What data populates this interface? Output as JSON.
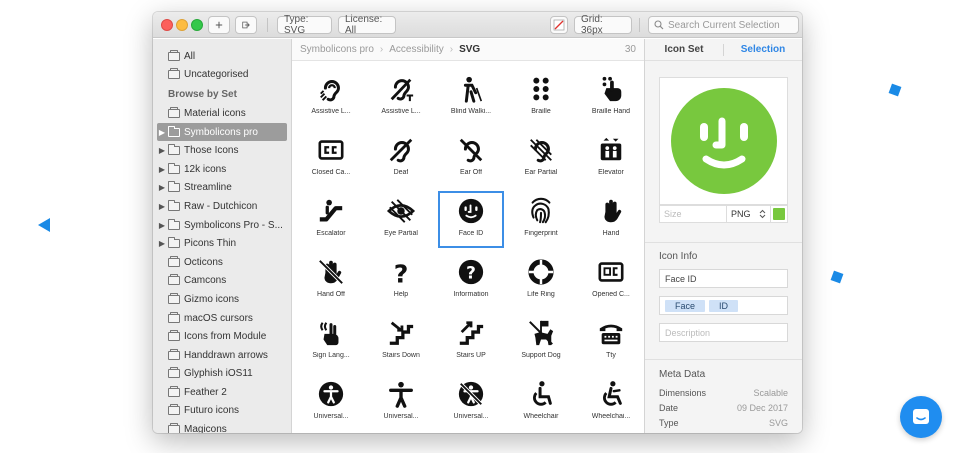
{
  "toolbar": {
    "type_filter": "Type: SVG",
    "license_filter": "License: All",
    "grid_size": "Grid: 36px",
    "search_placeholder": "Search Current Selection"
  },
  "sidebar": {
    "top_items": [
      {
        "label": "All"
      },
      {
        "label": "Uncategorised"
      }
    ],
    "section_header": "Browse by Set",
    "sets": [
      {
        "label": "Material icons",
        "expandable": false,
        "selected": false
      },
      {
        "label": "Symbolicons pro",
        "expandable": true,
        "selected": true
      },
      {
        "label": "Those Icons",
        "expandable": true,
        "selected": false
      },
      {
        "label": "12k icons",
        "expandable": true,
        "selected": false
      },
      {
        "label": "Streamline",
        "expandable": true,
        "selected": false
      },
      {
        "label": "Raw - Dutchicon",
        "expandable": true,
        "selected": false
      },
      {
        "label": "Symbolicons Pro - S...",
        "expandable": true,
        "selected": false
      },
      {
        "label": "Picons Thin",
        "expandable": true,
        "selected": false
      },
      {
        "label": "Octicons",
        "expandable": false,
        "selected": false
      },
      {
        "label": "Camcons",
        "expandable": false,
        "selected": false
      },
      {
        "label": "Gizmo icons",
        "expandable": false,
        "selected": false
      },
      {
        "label": "macOS cursors",
        "expandable": false,
        "selected": false
      },
      {
        "label": "Icons from Module",
        "expandable": false,
        "selected": false
      },
      {
        "label": "Handdrawn arrows",
        "expandable": false,
        "selected": false
      },
      {
        "label": "Glyphish iOS11",
        "expandable": false,
        "selected": false
      },
      {
        "label": "Feather 2",
        "expandable": false,
        "selected": false
      },
      {
        "label": "Futuro icons",
        "expandable": false,
        "selected": false
      },
      {
        "label": "Magicons",
        "expandable": false,
        "selected": false
      }
    ]
  },
  "breadcrumb": {
    "items": [
      "Symbolicons pro",
      "Accessibility",
      "SVG"
    ],
    "count": "30"
  },
  "icons": [
    {
      "label": "Assistive L...",
      "icon": "assistive-listening-icon"
    },
    {
      "label": "Assistive L...",
      "icon": "assistive-listening-t-icon"
    },
    {
      "label": "Blind Walki...",
      "icon": "blind-walking-icon"
    },
    {
      "label": "Braille",
      "icon": "braille-icon"
    },
    {
      "label": "Braille Hand",
      "icon": "braille-hand-icon"
    },
    {
      "label": "Closed Ca...",
      "icon": "closed-captions-icon"
    },
    {
      "label": "Deaf",
      "icon": "deaf-icon"
    },
    {
      "label": "Ear Off",
      "icon": "ear-off-icon"
    },
    {
      "label": "Ear Partial",
      "icon": "ear-partial-icon"
    },
    {
      "label": "Elevator",
      "icon": "elevator-icon"
    },
    {
      "label": "Escalator",
      "icon": "escalator-icon"
    },
    {
      "label": "Eye Partial",
      "icon": "eye-partial-icon"
    },
    {
      "label": "Face ID",
      "icon": "face-id-icon"
    },
    {
      "label": "Fingerprint",
      "icon": "fingerprint-icon"
    },
    {
      "label": "Hand",
      "icon": "hand-icon"
    },
    {
      "label": "Hand Off",
      "icon": "hand-off-icon"
    },
    {
      "label": "Help",
      "icon": "help-icon"
    },
    {
      "label": "Information",
      "icon": "information-icon"
    },
    {
      "label": "Life Ring",
      "icon": "life-ring-icon"
    },
    {
      "label": "Opened C...",
      "icon": "opened-captions-icon"
    },
    {
      "label": "Sign Lang...",
      "icon": "sign-language-icon"
    },
    {
      "label": "Stairs Down",
      "icon": "stairs-down-icon"
    },
    {
      "label": "Stairs UP",
      "icon": "stairs-up-icon"
    },
    {
      "label": "Support Dog",
      "icon": "support-dog-icon"
    },
    {
      "label": "Tty",
      "icon": "tty-icon"
    },
    {
      "label": "Universal...",
      "icon": "universal-access-icon"
    },
    {
      "label": "Universal...",
      "icon": "universal-person-icon"
    },
    {
      "label": "Universal...",
      "icon": "universal-off-icon"
    },
    {
      "label": "Wheelchair",
      "icon": "wheelchair-icon"
    },
    {
      "label": "Wheelchai...",
      "icon": "wheelchair-active-icon"
    }
  ],
  "selected_icon_index": 12,
  "right_panel": {
    "tabs": [
      "Icon Set",
      "Selection"
    ],
    "active_tab": "Selection",
    "preview_color": "#78c83e",
    "size_placeholder": "Size",
    "format": "PNG",
    "icon_info_title": "Icon Info",
    "name_value": "Face ID",
    "tags": [
      "Face",
      "ID"
    ],
    "description_placeholder": "Description",
    "meta_title": "Meta Data",
    "meta": [
      {
        "key": "Dimensions",
        "value": "Scalable"
      },
      {
        "key": "Date",
        "value": "09 Dec 2017"
      },
      {
        "key": "Type",
        "value": "SVG"
      }
    ]
  },
  "colors": {
    "accent": "#2f86e5",
    "decor": "#1a8ae6",
    "chat_button": "#1f8df0"
  }
}
